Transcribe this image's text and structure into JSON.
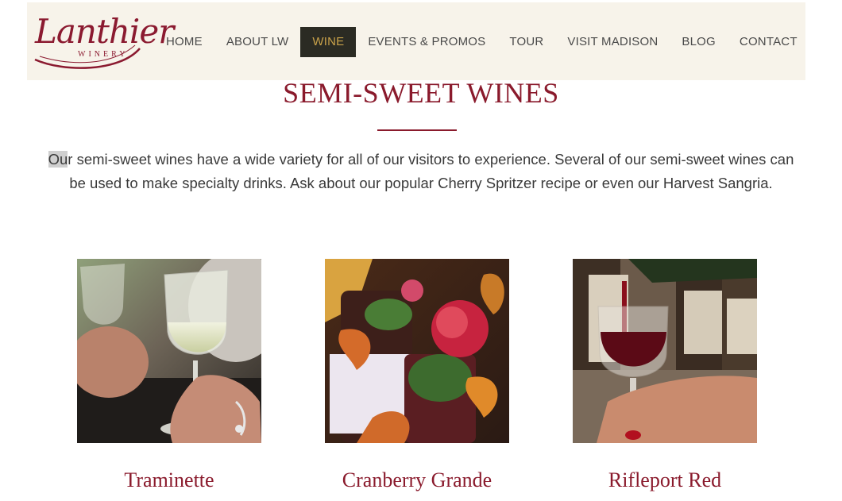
{
  "brand": {
    "logo_script": "Lanthier",
    "logo_sub": "WINERY",
    "color": "#8b1a30"
  },
  "nav": {
    "items": [
      {
        "label": "HOME",
        "active": false
      },
      {
        "label": "ABOUT LW",
        "active": false
      },
      {
        "label": "WINE",
        "active": true
      },
      {
        "label": "EVENTS & PROMOS",
        "active": false
      },
      {
        "label": "TOUR",
        "active": false
      },
      {
        "label": "VISIT MADISON",
        "active": false
      },
      {
        "label": "BLOG",
        "active": false
      },
      {
        "label": "CONTACT",
        "active": false
      }
    ],
    "active_bg": "#2b2b23",
    "active_fg": "#c9a24a"
  },
  "main": {
    "title": "SEMI-SWEET WINES",
    "intro_highlight": "Ou",
    "intro_rest": "r semi-sweet wines have a wide variety for all of our visitors to experience. Several of our semi-sweet wines can be used to make specialty drinks. Ask about our popular Cherry Spritzer recipe or even our Harvest Sangria.",
    "accent": "#8a1a2c"
  },
  "wines": [
    {
      "name": "Traminette",
      "image": "white-wine-glass-photo"
    },
    {
      "name": "Cranberry Grande",
      "image": "bottle-with-flowers-photo"
    },
    {
      "name": "Rifleport Red",
      "image": "red-wine-pour-photo"
    }
  ]
}
